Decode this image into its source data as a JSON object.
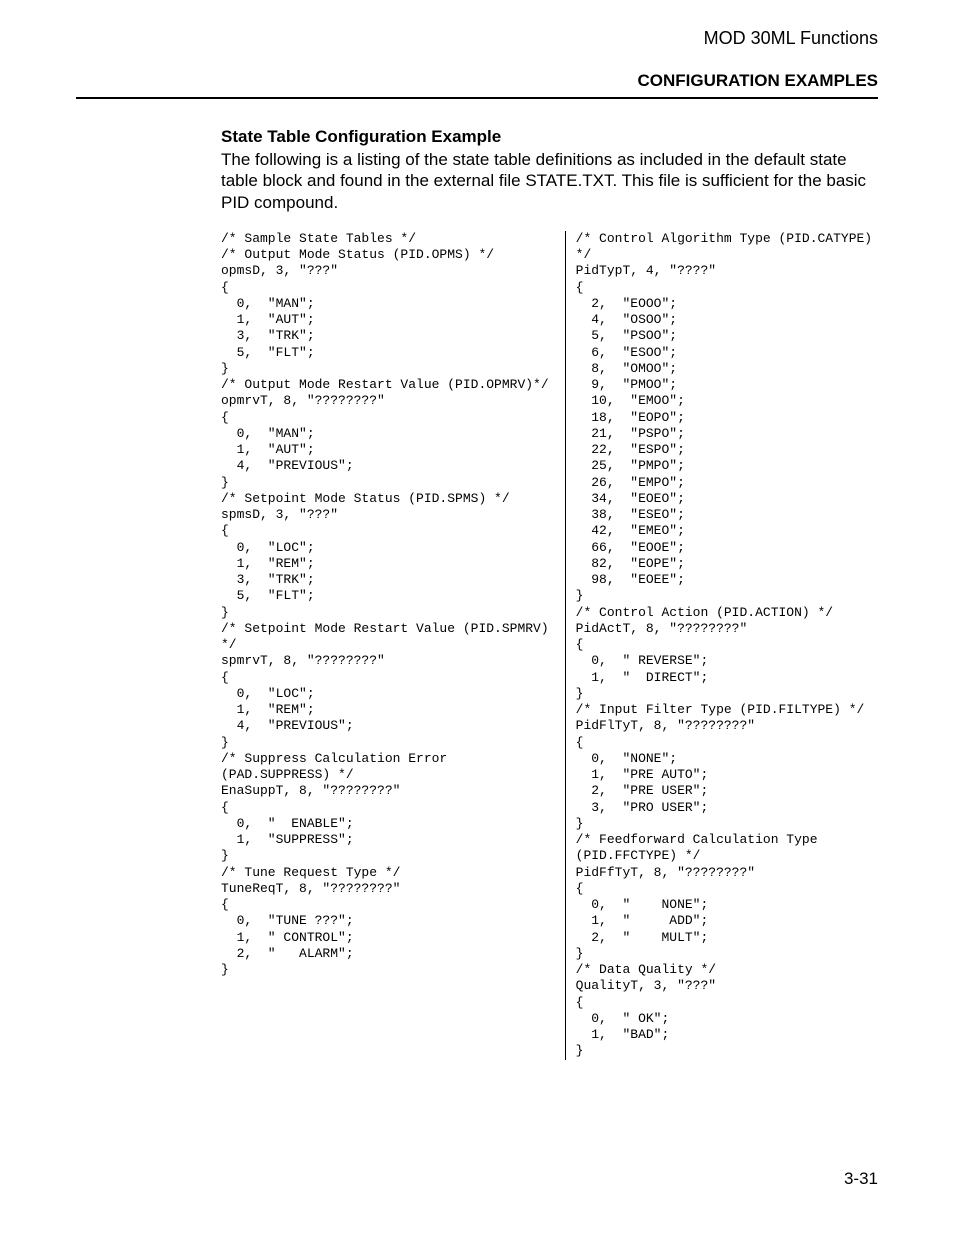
{
  "header": {
    "doc_title": "MOD 30ML Functions",
    "section_title": "CONFIGURATION EXAMPLES"
  },
  "section": {
    "heading": "State Table Configuration Example",
    "paragraph": "The following is a listing of the state table definitions as included in the default state table block and found in the external file STATE.TXT.  This file is sufficient for the basic PID compound."
  },
  "code": {
    "left": "/* Sample State Tables */\n/* Output Mode Status (PID.OPMS) */\nopmsD, 3, \"???\"\n{\n  0,  \"MAN\";\n  1,  \"AUT\";\n  3,  \"TRK\";\n  5,  \"FLT\";\n}\n/* Output Mode Restart Value (PID.OPMRV)*/\nopmrvT, 8, \"????????\"\n{\n  0,  \"MAN\";\n  1,  \"AUT\";\n  4,  \"PREVIOUS\";\n}\n/* Setpoint Mode Status (PID.SPMS) */\nspmsD, 3, \"???\"\n{\n  0,  \"LOC\";\n  1,  \"REM\";\n  3,  \"TRK\";\n  5,  \"FLT\";\n}\n/* Setpoint Mode Restart Value (PID.SPMRV)\n*/\nspmrvT, 8, \"????????\"\n{\n  0,  \"LOC\";\n  1,  \"REM\";\n  4,  \"PREVIOUS\";\n}\n/* Suppress Calculation Error\n(PAD.SUPPRESS) */\nEnaSuppT, 8, \"????????\"\n{\n  0,  \"  ENABLE\";\n  1,  \"SUPPRESS\";\n}\n/* Tune Request Type */\nTuneReqT, 8, \"????????\"\n{\n  0,  \"TUNE ???\";\n  1,  \" CONTROL\";\n  2,  \"   ALARM\";\n}",
    "right": "/* Control Algorithm Type (PID.CATYPE)\n*/\nPidTypT, 4, \"????\"\n{\n  2,  \"EOOO\";\n  4,  \"OSOO\";\n  5,  \"PSOO\";\n  6,  \"ESOO\";\n  8,  \"OMOO\";\n  9,  \"PMOO\";\n  10,  \"EMOO\";\n  18,  \"EOPO\";\n  21,  \"PSPO\";\n  22,  \"ESPO\";\n  25,  \"PMPO\";\n  26,  \"EMPO\";\n  34,  \"EOEO\";\n  38,  \"ESEO\";\n  42,  \"EMEO\";\n  66,  \"EOOE\";\n  82,  \"EOPE\";\n  98,  \"EOEE\";\n}\n/* Control Action (PID.ACTION) */\nPidActT, 8, \"????????\"\n{\n  0,  \" REVERSE\";\n  1,  \"  DIRECT\";\n}\n/* Input Filter Type (PID.FILTYPE) */\nPidFlTyT, 8, \"????????\"\n{\n  0,  \"NONE\";\n  1,  \"PRE AUTO\";\n  2,  \"PRE USER\";\n  3,  \"PRO USER\";\n}\n/* Feedforward Calculation Type\n(PID.FFCTYPE) */\nPidFfTyT, 8, \"????????\"\n{\n  0,  \"    NONE\";\n  1,  \"     ADD\";\n  2,  \"    MULT\";\n}\n/* Data Quality */\nQualityT, 3, \"???\"\n{\n  0,  \" OK\";\n  1,  \"BAD\";\n}"
  },
  "footer": {
    "page_number": "3-31"
  }
}
